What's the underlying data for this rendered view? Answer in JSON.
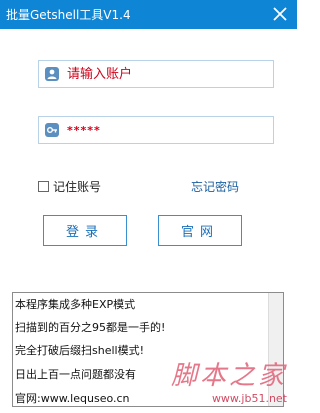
{
  "window": {
    "title": "批量Getshell工具V1.4"
  },
  "login_form": {
    "username_placeholder": "请输入账户",
    "password_value": "*****",
    "remember_label": "记住账号",
    "forgot_label": "忘记密码"
  },
  "buttons": {
    "login_label": "登录",
    "site_label": "官网"
  },
  "notes": [
    "本程序集成多种EXP模式",
    "扫描到的百分之95都是一手的!",
    "完全打破后缀扫shell模式!",
    "日出上百一点问题都没有",
    "官网:www.lequseo.cn"
  ],
  "watermark": {
    "text": "脚本之家",
    "url": "www.jb51.net"
  },
  "colors": {
    "titlebar": "#0f85d5",
    "accent": "#1a6fb8",
    "error_text": "#d0021b"
  },
  "icons": {
    "close": "close-icon",
    "user": "user-icon",
    "key": "key-icon"
  }
}
